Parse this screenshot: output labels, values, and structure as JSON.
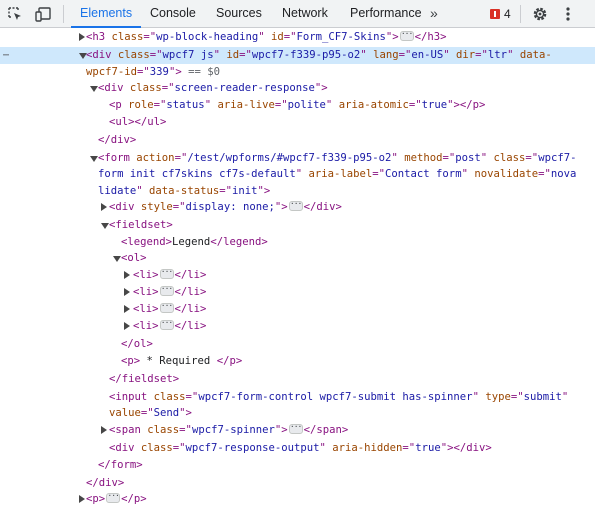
{
  "toolbar": {
    "tabs": [
      {
        "label": "Elements",
        "active": true
      },
      {
        "label": "Console",
        "active": false
      },
      {
        "label": "Sources",
        "active": false
      },
      {
        "label": "Network",
        "active": false
      },
      {
        "label": "Performance",
        "active": false
      }
    ],
    "more_tabs_glyph": "»",
    "issues_count": "4",
    "icons": [
      "inspect-element-icon",
      "device-toolbar-icon",
      "more-tabs-icon",
      "issues-icon",
      "settings-gear-icon",
      "more-options-icon"
    ],
    "accent_color": "#1a73e8",
    "issue_color": "#d93025"
  },
  "tree": {
    "selected_gutter": "⋯",
    "ellipsis_glyph": "···",
    "colors": {
      "tag": "#881280",
      "attr_name": "#994500",
      "attr_value": "#1a1aa6",
      "selection": "#cfe8fc"
    },
    "lines": [
      {
        "toggle": "closed",
        "parts": [
          [
            "t",
            "<h3 "
          ],
          [
            "a",
            "class"
          ],
          [
            "p",
            "=\""
          ],
          [
            "v",
            "wp-block-heading"
          ],
          [
            "p",
            "\" "
          ],
          [
            "a",
            "id"
          ],
          [
            "p",
            "=\""
          ],
          [
            "v",
            "Form_CF7-Skins"
          ],
          [
            "p",
            "\">"
          ],
          [
            "e",
            ""
          ],
          [
            "t",
            "</h3>"
          ]
        ]
      },
      {
        "toggle": "open",
        "selected": true,
        "parts": [
          [
            "t",
            "<div "
          ],
          [
            "a",
            "class"
          ],
          [
            "p",
            "=\""
          ],
          [
            "v",
            "wpcf7 js"
          ],
          [
            "p",
            "\" "
          ],
          [
            "a",
            "id"
          ],
          [
            "p",
            "=\""
          ],
          [
            "v",
            "wpcf7-f339-p95-o2"
          ],
          [
            "p",
            "\" "
          ],
          [
            "a",
            "lang"
          ],
          [
            "p",
            "=\""
          ],
          [
            "v",
            "en-US"
          ],
          [
            "p",
            "\" "
          ],
          [
            "a",
            "dir"
          ],
          [
            "p",
            "=\""
          ],
          [
            "v",
            "ltr"
          ],
          [
            "p",
            "\" "
          ],
          [
            "a",
            "data-"
          ]
        ]
      },
      {
        "toggle": "none",
        "cont": true,
        "parts": [
          [
            "a",
            "wpcf7-id"
          ],
          [
            "p",
            "=\""
          ],
          [
            "v",
            "339"
          ],
          [
            "p",
            "\">"
          ],
          [
            "c",
            " "
          ],
          [
            "d",
            "== $0"
          ]
        ]
      },
      {
        "toggle": "open",
        "parts": [
          [
            "t",
            "<div "
          ],
          [
            "a",
            "class"
          ],
          [
            "p",
            "=\""
          ],
          [
            "v",
            "screen-reader-response"
          ],
          [
            "p",
            "\">"
          ]
        ]
      },
      {
        "toggle": "none",
        "parts": [
          [
            "t",
            "<p "
          ],
          [
            "a",
            "role"
          ],
          [
            "p",
            "=\""
          ],
          [
            "v",
            "status"
          ],
          [
            "p",
            "\" "
          ],
          [
            "a",
            "aria-live"
          ],
          [
            "p",
            "=\""
          ],
          [
            "v",
            "polite"
          ],
          [
            "p",
            "\" "
          ],
          [
            "a",
            "aria-atomic"
          ],
          [
            "p",
            "=\""
          ],
          [
            "v",
            "true"
          ],
          [
            "p",
            "\">"
          ],
          [
            "t",
            "</p>"
          ]
        ]
      },
      {
        "toggle": "none",
        "parts": [
          [
            "t",
            "<ul>"
          ],
          [
            "t",
            "</ul>"
          ]
        ]
      },
      {
        "toggle": "none",
        "parts": [
          [
            "t",
            "</div>"
          ]
        ]
      },
      {
        "toggle": "open",
        "parts": [
          [
            "t",
            "<form "
          ],
          [
            "a",
            "action"
          ],
          [
            "p",
            "=\""
          ],
          [
            "v",
            "/test/wpforms/#wpcf7-f339-p95-o2"
          ],
          [
            "p",
            "\" "
          ],
          [
            "a",
            "method"
          ],
          [
            "p",
            "=\""
          ],
          [
            "v",
            "post"
          ],
          [
            "p",
            "\" "
          ],
          [
            "a",
            "class"
          ],
          [
            "p",
            "=\""
          ],
          [
            "v",
            "wpcf7-"
          ]
        ]
      },
      {
        "toggle": "none",
        "cont": true,
        "parts": [
          [
            "v",
            "form init cf7skins cf7s-default"
          ],
          [
            "p",
            "\" "
          ],
          [
            "a",
            "aria-label"
          ],
          [
            "p",
            "=\""
          ],
          [
            "v",
            "Contact form"
          ],
          [
            "p",
            "\" "
          ],
          [
            "a",
            "novalidate"
          ],
          [
            "p",
            "=\""
          ],
          [
            "v",
            "nova"
          ]
        ]
      },
      {
        "toggle": "none",
        "cont": true,
        "parts": [
          [
            "v",
            "lidate"
          ],
          [
            "p",
            "\" "
          ],
          [
            "a",
            "data-status"
          ],
          [
            "p",
            "=\""
          ],
          [
            "v",
            "init"
          ],
          [
            "p",
            "\">"
          ]
        ]
      },
      {
        "toggle": "closed",
        "parts": [
          [
            "t",
            "<div "
          ],
          [
            "a",
            "style"
          ],
          [
            "p",
            "=\""
          ],
          [
            "v",
            "display: none;"
          ],
          [
            "p",
            "\">"
          ],
          [
            "e",
            ""
          ],
          [
            "t",
            "</div>"
          ]
        ]
      },
      {
        "toggle": "open",
        "parts": [
          [
            "t",
            "<fieldset>"
          ]
        ]
      },
      {
        "toggle": "none",
        "parts": [
          [
            "t",
            "<legend>"
          ],
          [
            "c",
            "Legend"
          ],
          [
            "t",
            "</legend>"
          ]
        ]
      },
      {
        "toggle": "open",
        "parts": [
          [
            "t",
            "<ol>"
          ]
        ]
      },
      {
        "toggle": "closed",
        "parts": [
          [
            "t",
            "<li>"
          ],
          [
            "e",
            ""
          ],
          [
            "t",
            "</li>"
          ]
        ]
      },
      {
        "toggle": "closed",
        "parts": [
          [
            "t",
            "<li>"
          ],
          [
            "e",
            ""
          ],
          [
            "t",
            "</li>"
          ]
        ]
      },
      {
        "toggle": "closed",
        "parts": [
          [
            "t",
            "<li>"
          ],
          [
            "e",
            ""
          ],
          [
            "t",
            "</li>"
          ]
        ]
      },
      {
        "toggle": "closed",
        "parts": [
          [
            "t",
            "<li>"
          ],
          [
            "e",
            ""
          ],
          [
            "t",
            "</li>"
          ]
        ]
      },
      {
        "toggle": "none",
        "parts": [
          [
            "t",
            "</ol>"
          ]
        ]
      },
      {
        "toggle": "none",
        "parts": [
          [
            "t",
            "<p>"
          ],
          [
            "c",
            " * Required "
          ],
          [
            "t",
            "</p>"
          ]
        ]
      },
      {
        "toggle": "none",
        "parts": [
          [
            "t",
            "</fieldset>"
          ]
        ]
      },
      {
        "toggle": "none",
        "parts": [
          [
            "t",
            "<input "
          ],
          [
            "a",
            "class"
          ],
          [
            "p",
            "=\""
          ],
          [
            "v",
            "wpcf7-form-control wpcf7-submit has-spinner"
          ],
          [
            "p",
            "\" "
          ],
          [
            "a",
            "type"
          ],
          [
            "p",
            "=\""
          ],
          [
            "v",
            "submit"
          ],
          [
            "p",
            "\""
          ]
        ]
      },
      {
        "toggle": "none",
        "cont": true,
        "parts": [
          [
            "a",
            "value"
          ],
          [
            "p",
            "=\""
          ],
          [
            "v",
            "Send"
          ],
          [
            "p",
            "\">"
          ]
        ]
      },
      {
        "toggle": "closed",
        "parts": [
          [
            "t",
            "<span "
          ],
          [
            "a",
            "class"
          ],
          [
            "p",
            "=\""
          ],
          [
            "v",
            "wpcf7-spinner"
          ],
          [
            "p",
            "\">"
          ],
          [
            "e",
            ""
          ],
          [
            "t",
            "</span>"
          ]
        ]
      },
      {
        "toggle": "none",
        "parts": [
          [
            "t",
            "<div "
          ],
          [
            "a",
            "class"
          ],
          [
            "p",
            "=\""
          ],
          [
            "v",
            "wpcf7-response-output"
          ],
          [
            "p",
            "\" "
          ],
          [
            "a",
            "aria-hidden"
          ],
          [
            "p",
            "=\""
          ],
          [
            "v",
            "true"
          ],
          [
            "p",
            "\">"
          ],
          [
            "t",
            "</div>"
          ]
        ]
      },
      {
        "toggle": "none",
        "parts": [
          [
            "t",
            "</form>"
          ]
        ]
      },
      {
        "toggle": "none",
        "parts": [
          [
            "t",
            "</div>"
          ]
        ]
      },
      {
        "toggle": "closed",
        "parts": [
          [
            "t",
            "<p>"
          ],
          [
            "e",
            ""
          ],
          [
            "t",
            "</p>"
          ]
        ]
      }
    ]
  }
}
